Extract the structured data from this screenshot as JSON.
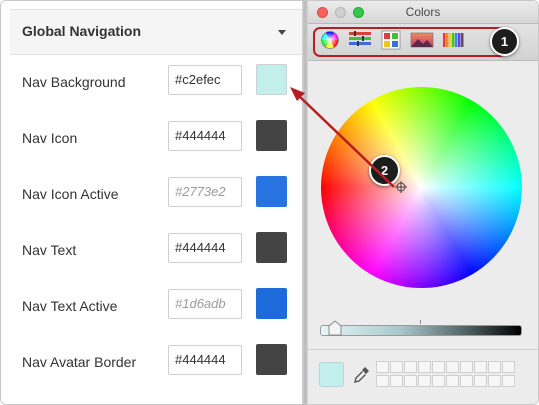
{
  "left_panel": {
    "title": "Global Navigation",
    "rows": [
      {
        "label": "Nav Background",
        "value": "#c2efec",
        "placeholder": "",
        "swatch": "#c2efec"
      },
      {
        "label": "Nav Icon",
        "value": "#444444",
        "placeholder": "",
        "swatch": "#444444"
      },
      {
        "label": "Nav Icon Active",
        "value": "",
        "placeholder": "#2773e2",
        "swatch": "#2773e2"
      },
      {
        "label": "Nav Text",
        "value": "#444444",
        "placeholder": "",
        "swatch": "#444444"
      },
      {
        "label": "Nav Text Active",
        "value": "",
        "placeholder": "#1d6adb",
        "swatch": "#1d6adb"
      },
      {
        "label": "Nav Avatar Border",
        "value": "#444444",
        "placeholder": "",
        "swatch": "#444444"
      }
    ]
  },
  "colors_window": {
    "title": "Colors",
    "toolbar_tools": [
      "color-wheel-icon",
      "color-sliders-icon",
      "color-palettes-icon",
      "image-palettes-icon",
      "pencils-icon"
    ],
    "brightness": 0.1,
    "current_color": "#c2efec"
  },
  "callouts": {
    "one": "1",
    "two": "2"
  },
  "colors": {
    "highlight": "#b61e24",
    "callout_bg": "#1d1d1d"
  }
}
